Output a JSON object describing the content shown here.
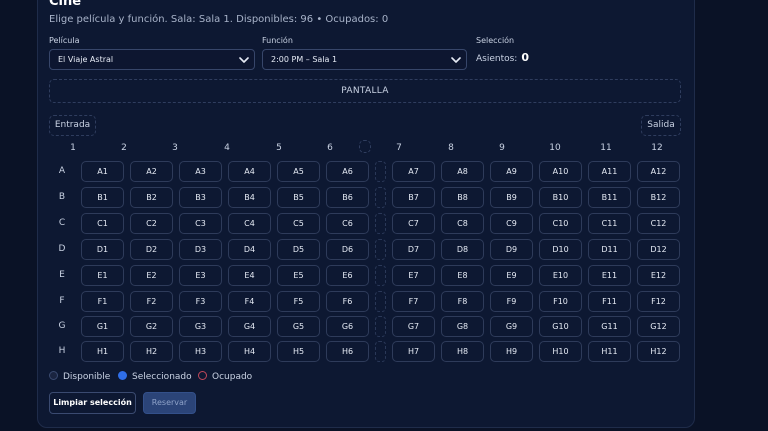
{
  "header": {
    "title": "Cine",
    "subtitle": "Elige película y función. Sala: Sala 1. Disponibles: 96 • Ocupados: 0"
  },
  "controls": {
    "movie_label": "Película",
    "movie_value": "El Viaje Astral",
    "showtime_label": "Función",
    "showtime_value": "2:00 PM – Sala 1",
    "selection_label": "Selección",
    "seats_label": "Asientos:",
    "seats_count": "0"
  },
  "screen_label": "PANTALLA",
  "entrance_label": "Entrada",
  "exit_label": "Salida",
  "columns": [
    "1",
    "2",
    "3",
    "4",
    "5",
    "6",
    "7",
    "8",
    "9",
    "10",
    "11",
    "12"
  ],
  "rows": [
    "A",
    "B",
    "C",
    "D",
    "E",
    "F",
    "G",
    "H"
  ],
  "legend": {
    "available": "Disponible",
    "selected": "Seleccionado",
    "occupied": "Ocupado"
  },
  "actions": {
    "clear": "Limpiar selección",
    "reserve": "Reservar"
  },
  "colors": {
    "selected_dot": "#2f6ee8",
    "occupied_ring": "#c0485a",
    "available_dot": "#1a2440"
  }
}
